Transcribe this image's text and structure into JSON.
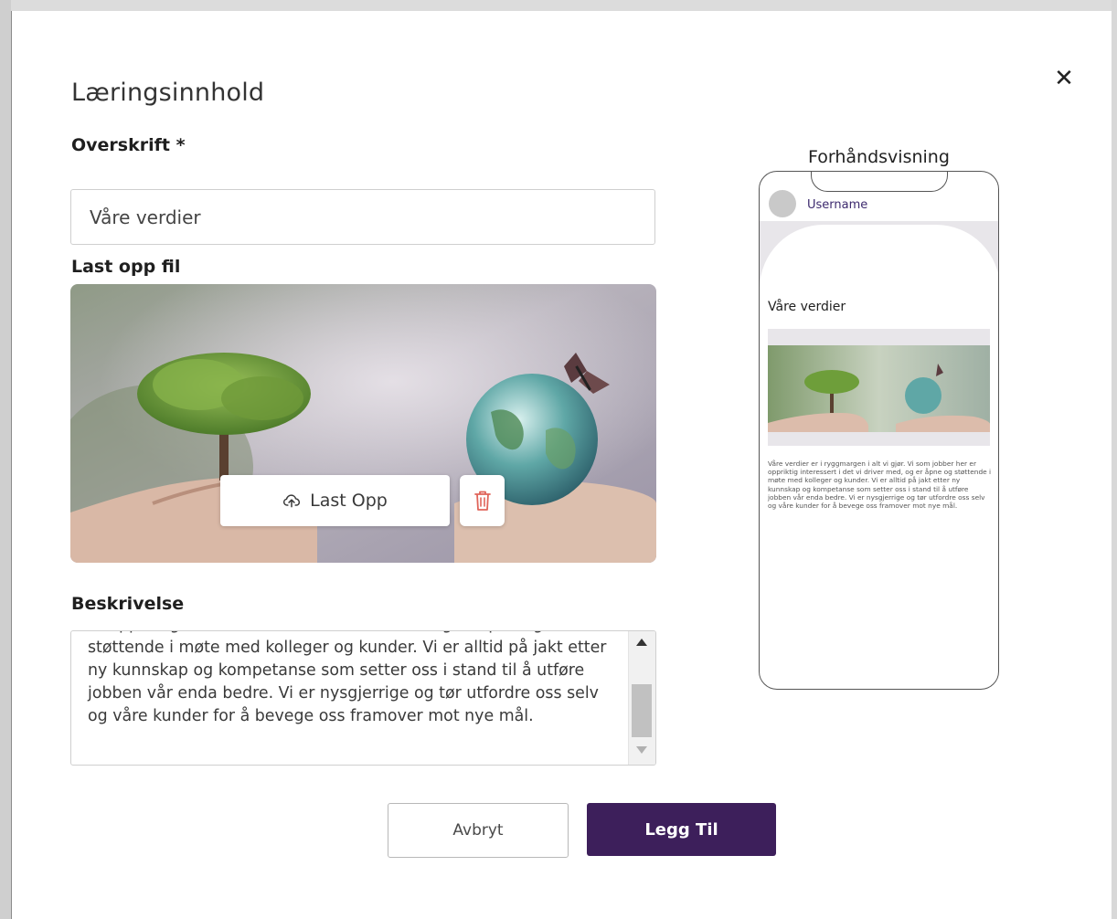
{
  "modal": {
    "title": "Læringsinnhold",
    "close_symbol": "✕"
  },
  "form": {
    "heading_label": "Overskrift *",
    "heading_value": "Våre verdier",
    "upload_label": "Last opp fil",
    "upload_button_label": "Last Opp",
    "description_label": "Beskrivelse",
    "description_text": "er oppriktig interessert i det vi driver med, og er åpne og støttende i møte med kolleger og kunder. Vi er alltid på jakt etter ny kunnskap og kompetanse som setter oss i stand til å utføre jobben vår enda bedre. Vi er nysgjerrige og tør utfordre oss selv og våre kunder for å bevege oss framover mot nye mål."
  },
  "actions": {
    "cancel_label": "Avbryt",
    "add_label": "Legg Til"
  },
  "preview": {
    "title": "Forhåndsvisning",
    "username": "Username",
    "heading": "Våre verdier",
    "description": "Våre verdier er i ryggmargen i alt vi gjør. Vi som jobber her er oppriktig interessert i det vi driver med, og er åpne og støttende i møte med kolleger og kunder. Vi er alltid på jakt etter ny kunnskap og kompetanse som setter oss i stand til å utføre jobben vår enda bedre. Vi er nysgjerrige og tør utfordre oss selv og våre kunder for å bevege oss framover mot nye mål."
  },
  "icons": {
    "close": "close-icon",
    "upload": "cloud-upload-icon",
    "delete": "trash-icon"
  },
  "colors": {
    "primary": "#3d1f5b",
    "danger": "#e0645a",
    "preview_username": "#3d2a6e"
  }
}
